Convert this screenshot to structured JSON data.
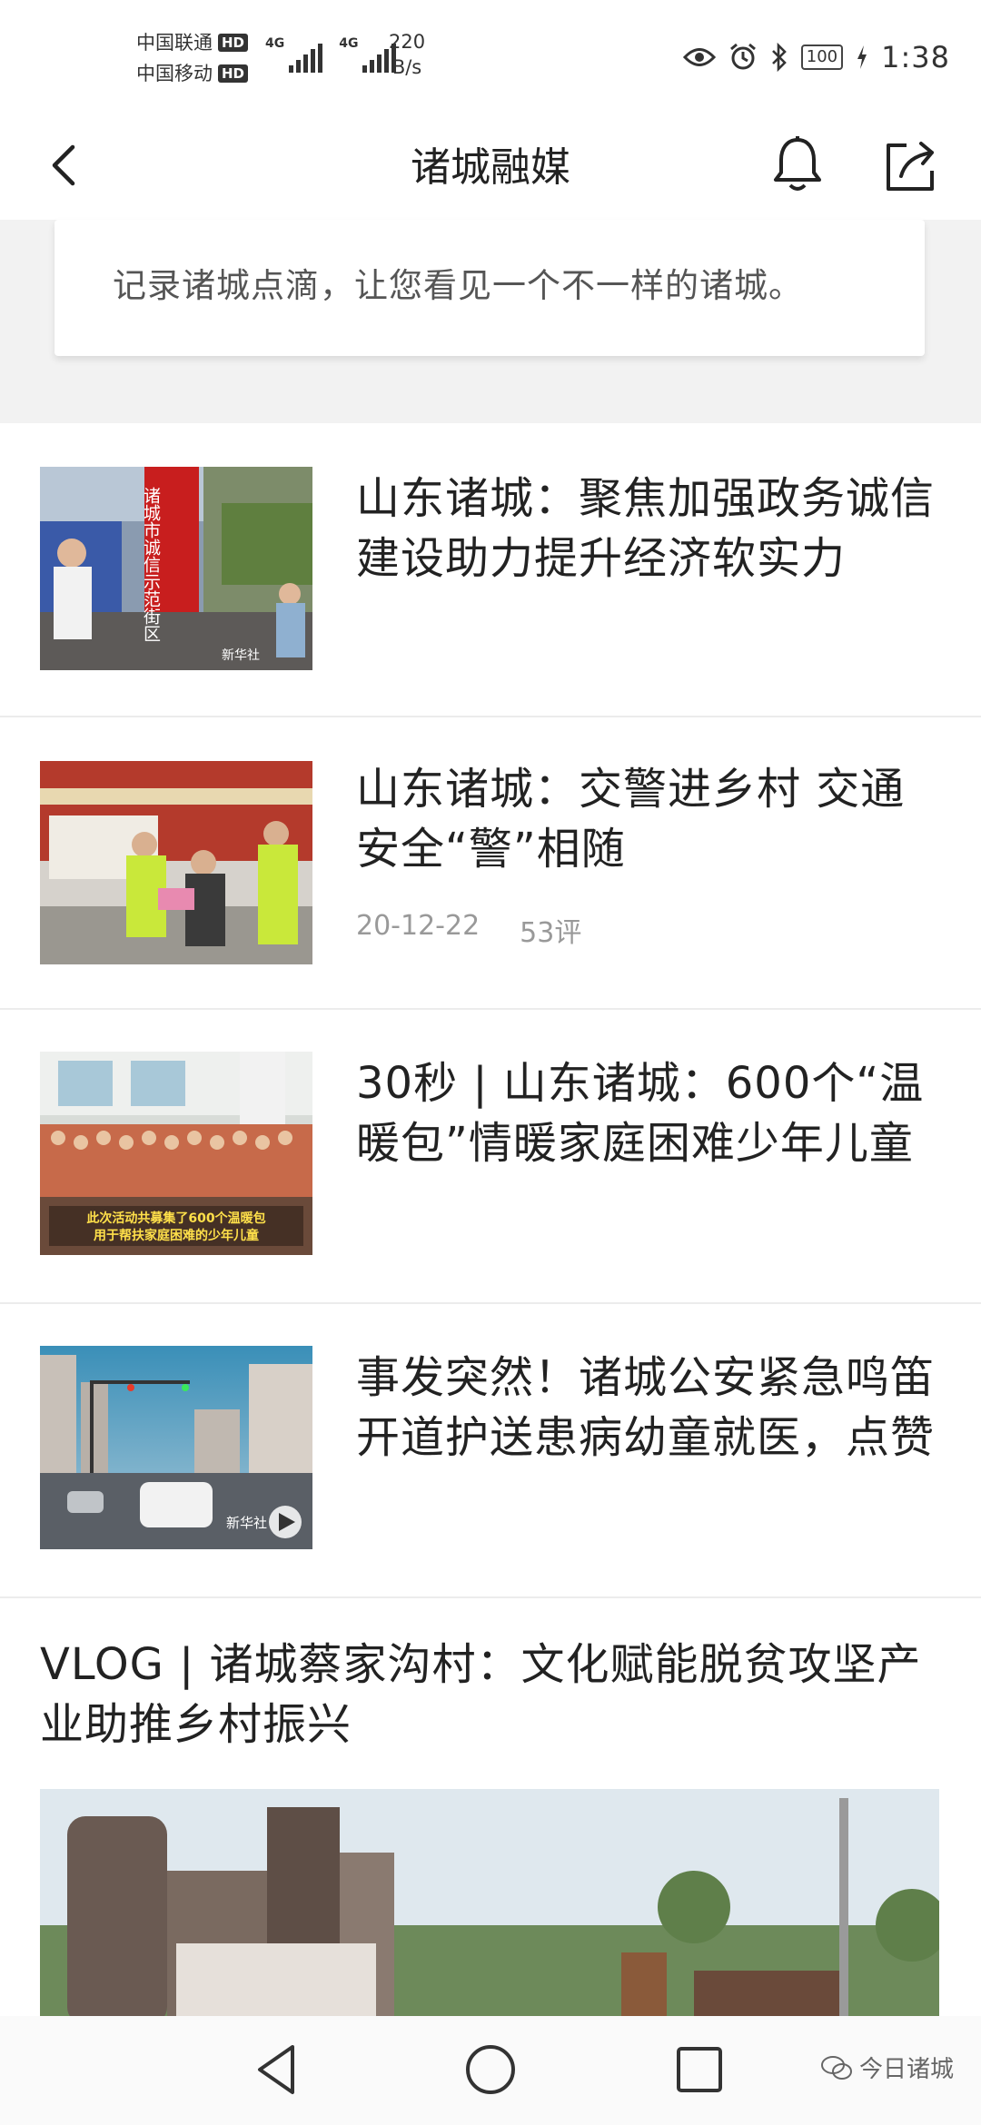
{
  "status_bar": {
    "carrier1": "中国联通",
    "carrier2": "中国移动",
    "hd": "HD",
    "net1": "4G",
    "net2": "4G",
    "speed_value": "220",
    "speed_unit": "B/s",
    "battery": "100",
    "time": "1:38"
  },
  "header": {
    "title": "诸城融媒"
  },
  "intro": {
    "text": "记录诸城点滴，让您看见一个不一样的诸城。"
  },
  "feed": {
    "items": [
      {
        "title": "山东诸城：聚焦加强政务诚信建设助力提升经济软实力"
      },
      {
        "title": "山东诸城：交警进乡村 交通安全“警”相随",
        "date": "20-12-22",
        "comments": "53评"
      },
      {
        "title": "30秒 | 山东诸城：600个“温暖包”情暖家庭困难少年儿童",
        "caption_line1": "此次活动共募集了600个温暖包",
        "caption_line2": "用于帮扶家庭困难的少年儿童"
      },
      {
        "title": "事发突然！诸城公安紧急鸣笛开道护送患病幼童就医，点赞"
      }
    ],
    "vlog": {
      "title": "VLOG | 诸城蔡家沟村：文化赋能脱贫攻坚产业助推乡村振兴"
    }
  },
  "thumb_texts": {
    "sign_vertical": "诸城市诚信示范街区",
    "xinhua": "新华社",
    "xinhua2": "新华社"
  },
  "watermark": {
    "text": "今日诸城"
  },
  "colors": {
    "accent_red": "#c81e1e",
    "text": "#222222",
    "meta": "#999999"
  }
}
